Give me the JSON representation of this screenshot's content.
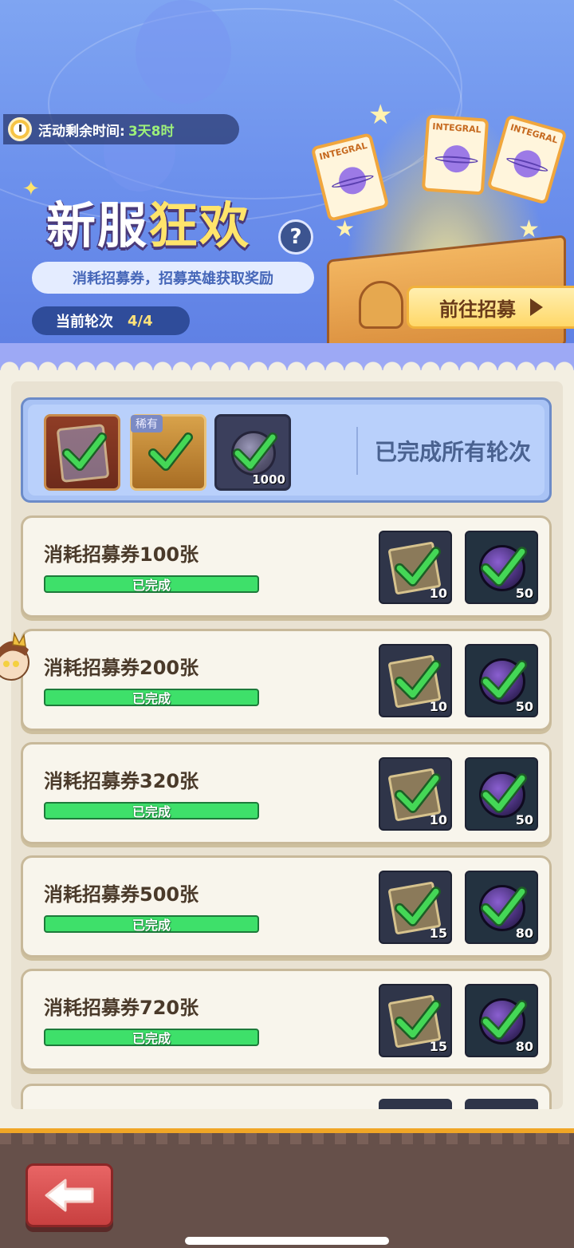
{
  "banner": {
    "timer_label": "活动剩余时间:",
    "timer_value": "3天8时",
    "title_part1": "新服",
    "title_part2": "狂欢",
    "help_glyph": "?",
    "subtitle": "消耗招募券，招募英雄获取奖励",
    "round_label": "当前轮次",
    "round_value": "4/4",
    "goto_button": "前往招募"
  },
  "summary": {
    "rare_tag": "稀有",
    "coin_count": "1000",
    "status": "已完成所有轮次"
  },
  "tasks": [
    {
      "name": "消耗招募券100张",
      "status": "已完成",
      "ticket_count": "10",
      "coin_count": "50"
    },
    {
      "name": "消耗招募券200张",
      "status": "已完成",
      "ticket_count": "10",
      "coin_count": "50"
    },
    {
      "name": "消耗招募券320张",
      "status": "已完成",
      "ticket_count": "10",
      "coin_count": "50"
    },
    {
      "name": "消耗招募券500张",
      "status": "已完成",
      "ticket_count": "15",
      "coin_count": "80"
    },
    {
      "name": "消耗招募券720张",
      "status": "已完成",
      "ticket_count": "15",
      "coin_count": "80"
    }
  ],
  "ticket_tag": "INTEGRAL",
  "colors": {
    "banner_blue": "#6b8fec",
    "progress_green": "#3ee06a",
    "check_green": "#3ad14a",
    "button_red": "#d85050",
    "accent_gold": "#f0a626"
  },
  "icons": [
    "clock-icon",
    "help-icon",
    "check-icon",
    "ticket-icon",
    "coin-icon",
    "back-arrow-icon",
    "play-triangle-icon"
  ]
}
